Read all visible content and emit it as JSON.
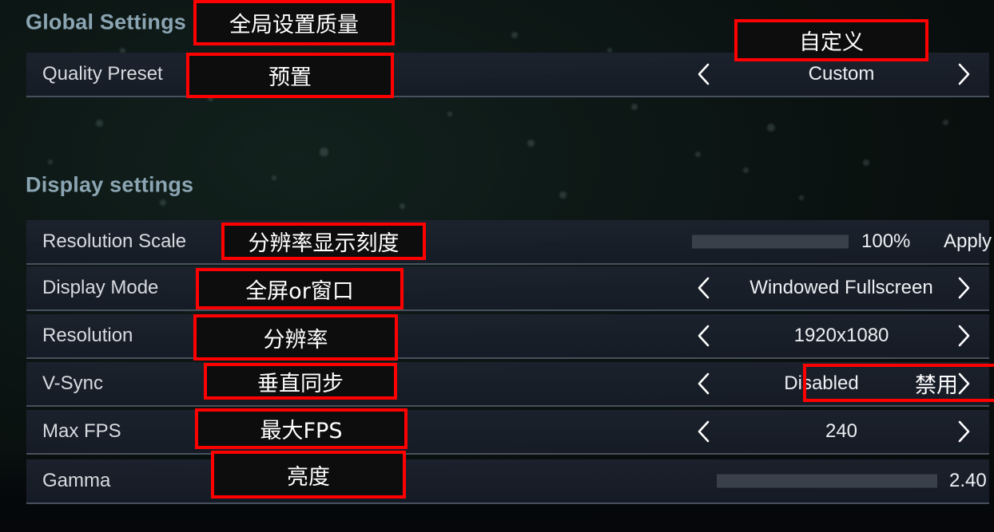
{
  "background": {
    "color": "#0c1614",
    "accent_heading": "#8ba5b3"
  },
  "sections": [
    {
      "id": "global",
      "title": "Global Settings"
    },
    {
      "id": "display",
      "title": "Display settings"
    }
  ],
  "rows": [
    {
      "id": "quality-preset",
      "label": "Quality Preset",
      "control": "selector",
      "value": "Custom",
      "left_icon": "chevron-left-icon",
      "right_icon": "chevron-right-icon"
    },
    {
      "id": "resolution-scale",
      "label": "Resolution Scale",
      "control": "slider",
      "value": "100%",
      "fill_percent": 100,
      "apply_label": "Apply"
    },
    {
      "id": "display-mode",
      "label": "Display Mode",
      "control": "selector",
      "value": "Windowed Fullscreen",
      "left_icon": "chevron-left-icon",
      "right_icon": "chevron-right-icon"
    },
    {
      "id": "resolution",
      "label": "Resolution",
      "control": "selector",
      "value": "1920x1080",
      "left_icon": "chevron-left-icon",
      "right_icon": "chevron-right-icon"
    },
    {
      "id": "v-sync",
      "label": "V-Sync",
      "control": "selector",
      "value": "Disabled",
      "left_icon": "chevron-left-icon",
      "right_icon": "chevron-right-icon"
    },
    {
      "id": "max-fps",
      "label": "Max FPS",
      "control": "selector",
      "value": "240",
      "left_icon": "chevron-left-icon",
      "right_icon": "chevron-right-icon"
    },
    {
      "id": "gamma",
      "label": "Gamma",
      "control": "slider",
      "value": "2.40",
      "fill_percent": 48
    }
  ],
  "annotations": {
    "border_color": "#ff0000",
    "items": [
      {
        "id": "anno-global-settings-quality",
        "text": "全局设置质量"
      },
      {
        "id": "anno-preset",
        "text": "预置"
      },
      {
        "id": "anno-custom",
        "text": "自定义"
      },
      {
        "id": "anno-resolution-scale",
        "text": "分辨率显示刻度"
      },
      {
        "id": "anno-display-mode",
        "text": "全屏or窗口"
      },
      {
        "id": "anno-resolution",
        "text": "分辨率"
      },
      {
        "id": "anno-vsync",
        "text": "垂直同步"
      },
      {
        "id": "anno-vsync-disabled",
        "text": "禁用"
      },
      {
        "id": "anno-max-fps",
        "text": "最大FPS"
      },
      {
        "id": "anno-gamma",
        "text": "亮度"
      }
    ]
  }
}
